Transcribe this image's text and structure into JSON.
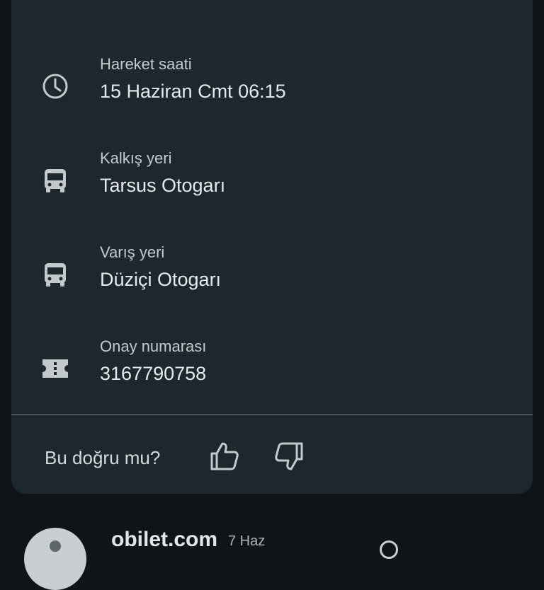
{
  "card": {
    "top_title": "",
    "rows": [
      {
        "icon": "clock-icon",
        "label": "Hareket saati",
        "value": "15 Haziran Cmt 06:15"
      },
      {
        "icon": "bus-icon",
        "label": "Kalkış yeri",
        "value": "Tarsus Otogarı"
      },
      {
        "icon": "bus-icon",
        "label": "Varış yeri",
        "value": "Düziçi Otogarı"
      },
      {
        "icon": "ticket-icon",
        "label": "Onay numarası",
        "value": "3167790758"
      }
    ],
    "feedback": {
      "question": "Bu doğru mu?",
      "like_icon": "thumbs-up-icon",
      "dislike_icon": "thumbs-down-icon"
    }
  },
  "next_item": {
    "sender": "obilet.com",
    "date": "7 Haz"
  },
  "colors": {
    "background": "#111416",
    "card": "#1d282e",
    "text_primary": "#e6e9eb",
    "text_secondary": "#c4c9cc",
    "divider": "#4a555b"
  }
}
